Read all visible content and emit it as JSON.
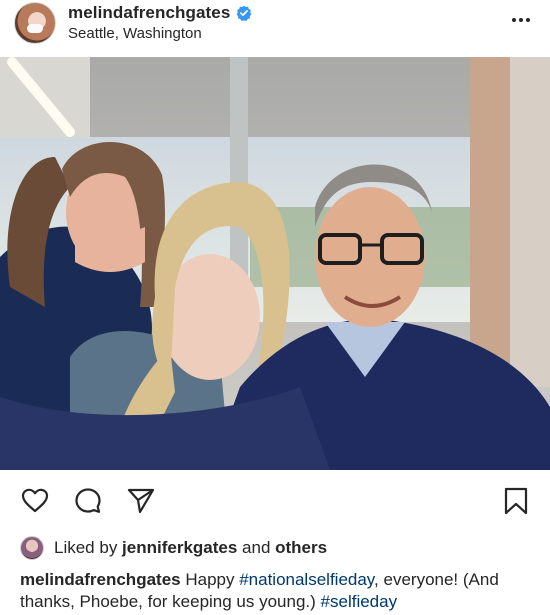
{
  "post": {
    "username": "melindafrenchgates",
    "location": "Seattle, Washington",
    "verified": true,
    "liked_by_prefix": "Liked by ",
    "liked_by_user": "jenniferkgates",
    "liked_by_conjunction": " and ",
    "liked_by_others": "others",
    "caption_user": "melindafrenchgates",
    "caption_part1": " Happy ",
    "caption_tag1": "#nationalselfieday",
    "caption_part2": ", everyone! (And thanks, Phoebe, for keeping us young.) ",
    "caption_tag2": "#selfieday"
  },
  "icons": {
    "more": "more-options-icon",
    "like": "heart-icon",
    "comment": "comment-icon",
    "share": "share-icon",
    "save": "bookmark-icon"
  },
  "colors": {
    "verified": "#3897f0",
    "hashtag": "#00376b",
    "text": "#262626"
  }
}
